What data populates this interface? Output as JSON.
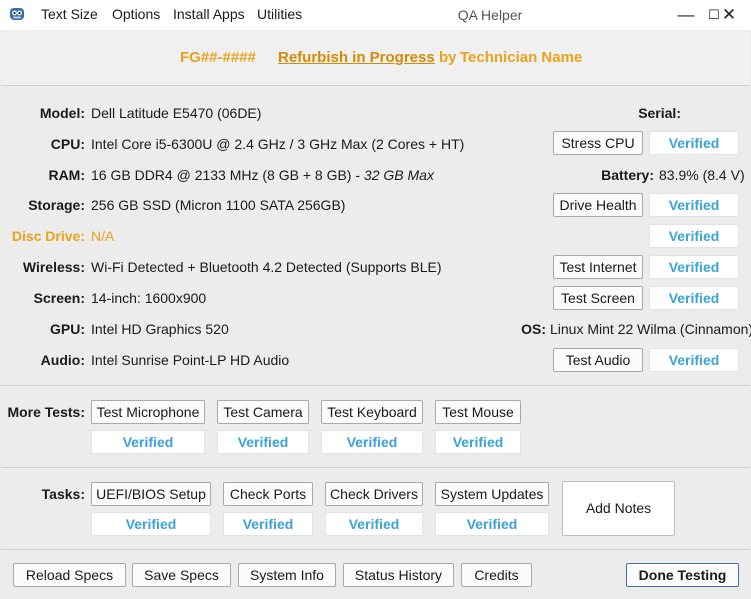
{
  "window": {
    "title": "QA Helper",
    "minimize_glyph": "—",
    "maximize_glyph": "☐",
    "close_glyph": "✕",
    "menu": [
      "Text Size",
      "Options",
      "Install Apps",
      "Utilities"
    ]
  },
  "header": {
    "asset_id": "FG##-####",
    "status_link": "Refurbish in Progress",
    "by_text": "by",
    "technician": "Technician Name"
  },
  "specs": {
    "model_label": "Model:",
    "model_value": "Dell Latitude E5470 (06DE)",
    "serial_label": "Serial:",
    "cpu_label": "CPU:",
    "cpu_value": "Intel Core i5-6300U @ 2.4 GHz / 3 GHz Max (2 Cores + HT)",
    "ram_label": "RAM:",
    "ram_value": "16 GB DDR4 @ 2133 MHz (8 GB + 8 GB) - ",
    "ram_max": "32 GB Max",
    "battery_label": "Battery:",
    "battery_value": "83.9% (8.4 V)",
    "storage_label": "Storage:",
    "storage_value": "256 GB SSD (Micron 1100 SATA 256GB)",
    "disc_label": "Disc Drive:",
    "disc_value": "N/A",
    "wireless_label": "Wireless:",
    "wireless_value": "Wi-Fi Detected + Bluetooth 4.2 Detected (Supports BLE)",
    "screen_label": "Screen:",
    "screen_value": "14-inch: 1600x900",
    "gpu_label": "GPU:",
    "gpu_value": "Intel HD Graphics 520",
    "os_label": "OS:",
    "os_value": "Linux Mint 22 Wilma (Cinnamon)",
    "audio_label": "Audio:",
    "audio_value": "Intel Sunrise Point-LP HD Audio"
  },
  "spec_tests": {
    "stress_cpu": "Stress CPU",
    "drive_health": "Drive Health",
    "test_internet": "Test Internet",
    "test_screen": "Test Screen",
    "test_audio": "Test Audio",
    "status": "Verified"
  },
  "more_tests": {
    "label": "More Tests:",
    "buttons": [
      "Test Microphone",
      "Test Camera",
      "Test Keyboard",
      "Test Mouse"
    ],
    "status": "Verified"
  },
  "tasks": {
    "label": "Tasks:",
    "buttons": [
      "UEFI/BIOS Setup",
      "Check Ports",
      "Check Drivers",
      "System Updates"
    ],
    "status": "Verified",
    "add_notes": "Add Notes"
  },
  "footer": {
    "buttons": [
      "Reload Specs",
      "Save Specs",
      "System Info",
      "Status History",
      "Credits"
    ],
    "done": "Done Testing"
  },
  "colors": {
    "accent_orange": "#e8a21c",
    "verified_blue": "#3aa3d8"
  }
}
